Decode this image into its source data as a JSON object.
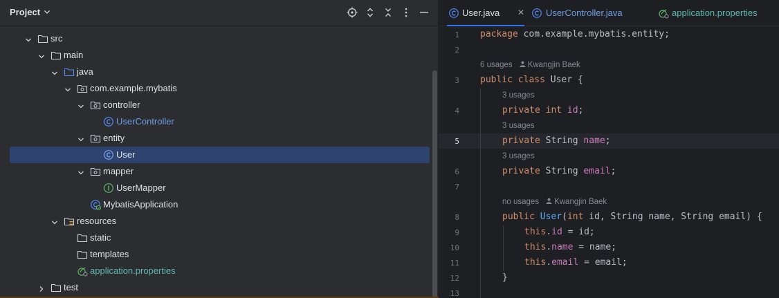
{
  "project_panel": {
    "title": "Project",
    "tree": [
      {
        "label": "src",
        "kind": "folder",
        "expanded": true
      },
      {
        "label": "main",
        "kind": "folder",
        "expanded": true
      },
      {
        "label": "java",
        "kind": "source-folder",
        "expanded": true
      },
      {
        "label": "com.example.mybatis",
        "kind": "package",
        "expanded": true
      },
      {
        "label": "controller",
        "kind": "package",
        "expanded": true
      },
      {
        "label": "UserController",
        "kind": "class"
      },
      {
        "label": "entity",
        "kind": "package",
        "expanded": true
      },
      {
        "label": "User",
        "kind": "class",
        "selected": true
      },
      {
        "label": "mapper",
        "kind": "package",
        "expanded": true
      },
      {
        "label": "UserMapper",
        "kind": "interface"
      },
      {
        "label": "MybatisApplication",
        "kind": "spring-app-class"
      },
      {
        "label": "resources",
        "kind": "resources-folder",
        "expanded": true
      },
      {
        "label": "static",
        "kind": "folder"
      },
      {
        "label": "templates",
        "kind": "folder"
      },
      {
        "label": "application.properties",
        "kind": "properties-file"
      },
      {
        "label": "test",
        "kind": "folder",
        "expanded": false
      }
    ]
  },
  "editor": {
    "tabs": [
      {
        "label": "User.java",
        "active": true
      },
      {
        "label": "UserController.java",
        "active": false
      },
      {
        "label": "application.properties",
        "active": false
      }
    ],
    "line_numbers": [
      "1",
      "2",
      "3",
      "4",
      "5",
      "6",
      "7",
      "8",
      "9",
      "10",
      "11",
      "12",
      "13"
    ],
    "current_line": "5",
    "code": {
      "l1_kw": "package",
      "l1_rest": " com.example.mybatis.entity;",
      "l3_kw": "public class",
      "l3_rest": " User {",
      "l4_kw": "private int",
      "l4_fld": "id",
      "l5_kw": "private",
      "l5_type": " String ",
      "l5_fld": "name",
      "l6_kw": "private",
      "l6_type": " String ",
      "l6_fld": "email",
      "l8_kw": "public",
      "l8_fn": "User",
      "l8_open": "(",
      "l8_kw2": "int",
      "l8_rest": " id, String name, String email) {",
      "l9_kw": "this",
      "l9_dot": ".",
      "l9_fld": "id",
      "l9_rest": " = id;",
      "l10_kw": "this",
      "l10_dot": ".",
      "l10_fld": "name",
      "l10_rest": " = name;",
      "l11_kw": "this",
      "l11_dot": ".",
      "l11_fld": "email",
      "l11_rest": " = email;",
      "l12": "}",
      "semi": ";",
      "space": " "
    },
    "hints": {
      "class_usages": "6 usages",
      "class_author": "Kwangjin Baek",
      "id_usages": "3 usages",
      "name_usages": "3 usages",
      "email_usages": "3 usages",
      "ctor_usages": "no usages",
      "ctor_author": "Kwangjin Baek"
    }
  },
  "colors": {
    "selection": "#2e436e",
    "keyword": "#cf8e6d",
    "field": "#c77dbb",
    "function": "#56a8f5",
    "link_blue": "#6f9fe6"
  }
}
